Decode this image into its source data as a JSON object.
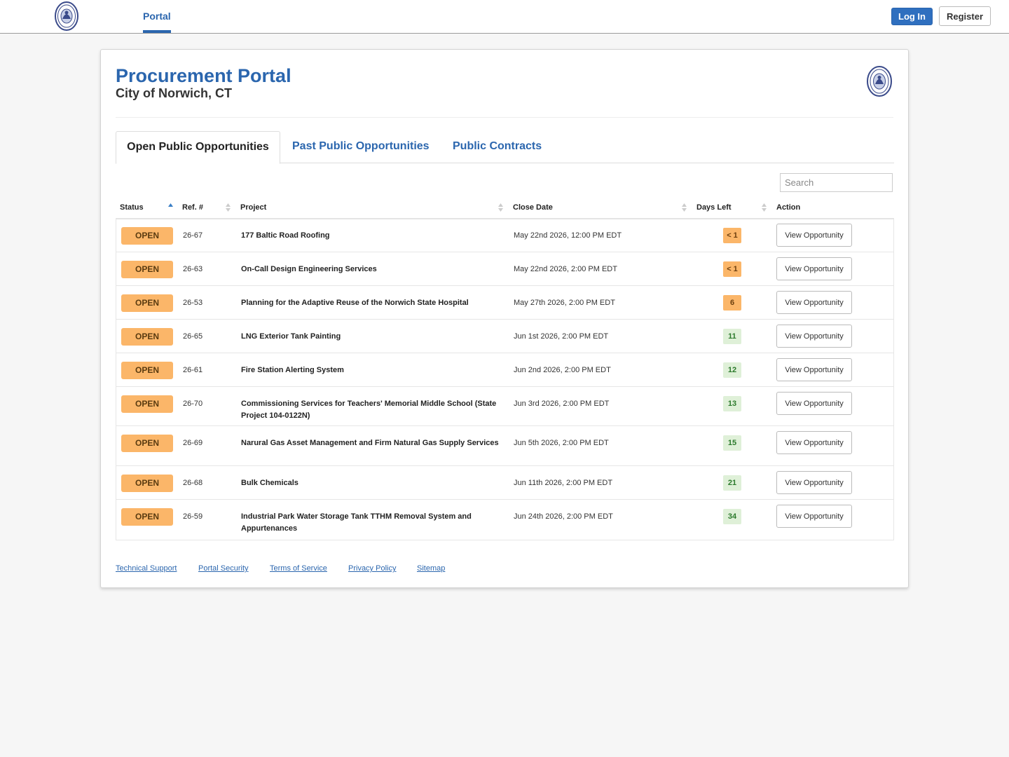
{
  "nav": {
    "portal_label": "Portal",
    "login_label": "Log In",
    "register_label": "Register"
  },
  "header": {
    "title": "Procurement Portal",
    "subtitle": "City of Norwich, CT"
  },
  "tabs": [
    {
      "label": "Open Public Opportunities",
      "active": true
    },
    {
      "label": "Past Public Opportunities",
      "active": false
    },
    {
      "label": "Public Contracts",
      "active": false
    }
  ],
  "search": {
    "placeholder": "Search",
    "value": ""
  },
  "table": {
    "columns": [
      "Status",
      "Ref. #",
      "Project",
      "Close Date",
      "Days Left",
      "Action"
    ],
    "rows": [
      {
        "status": "OPEN",
        "ref": "26-67",
        "project": "177 Baltic Road Roofing",
        "close": "May 22nd 2026, 12:00 PM EDT",
        "days": "< 1",
        "urgent": true,
        "action": "View Opportunity"
      },
      {
        "status": "OPEN",
        "ref": "26-63",
        "project": "On-Call Design Engineering Services",
        "close": "May 22nd 2026, 2:00 PM EDT",
        "days": "< 1",
        "urgent": true,
        "action": "View Opportunity"
      },
      {
        "status": "OPEN",
        "ref": "26-53",
        "project": "Planning for the Adaptive Reuse of the Norwich State Hospital",
        "close": "May 27th 2026, 2:00 PM EDT",
        "days": "6",
        "urgent": true,
        "action": "View Opportunity"
      },
      {
        "status": "OPEN",
        "ref": "26-65",
        "project": "LNG Exterior Tank Painting",
        "close": "Jun 1st 2026, 2:00 PM EDT",
        "days": "11",
        "urgent": false,
        "action": "View Opportunity"
      },
      {
        "status": "OPEN",
        "ref": "26-61",
        "project": "Fire Station Alerting System",
        "close": "Jun 2nd 2026, 2:00 PM EDT",
        "days": "12",
        "urgent": false,
        "action": "View Opportunity"
      },
      {
        "status": "OPEN",
        "ref": "26-70",
        "project": "Commissioning Services for Teachers' Memorial Middle School (State Project 104-0122N)",
        "close": "Jun 3rd 2026, 2:00 PM EDT",
        "days": "13",
        "urgent": false,
        "action": "View Opportunity"
      },
      {
        "status": "OPEN",
        "ref": "26-69",
        "project": "Narural Gas Asset Management and Firm Natural Gas Supply Services",
        "close": "Jun 5th 2026, 2:00 PM EDT",
        "days": "15",
        "urgent": false,
        "action": "View Opportunity"
      },
      {
        "status": "OPEN",
        "ref": "26-68",
        "project": "Bulk Chemicals",
        "close": "Jun 11th 2026, 2:00 PM EDT",
        "days": "21",
        "urgent": false,
        "action": "View Opportunity"
      },
      {
        "status": "OPEN",
        "ref": "26-59",
        "project": "Industrial Park Water Storage Tank TTHM Removal System and Appurtenances",
        "close": "Jun 24th 2026, 2:00 PM EDT",
        "days": "34",
        "urgent": false,
        "action": "View Opportunity"
      }
    ]
  },
  "footer": {
    "links": [
      "Technical Support",
      "Portal Security",
      "Terms of Service",
      "Privacy Policy",
      "Sitemap"
    ]
  },
  "colors": {
    "brand": "#2b66ae",
    "status_badge": "#fbb669",
    "days_ok_bg": "#dff0d8",
    "days_ok_text": "#2c7a2c"
  },
  "icons": {
    "logo": "city-seal-icon",
    "sort": "sort-arrows-icon"
  }
}
